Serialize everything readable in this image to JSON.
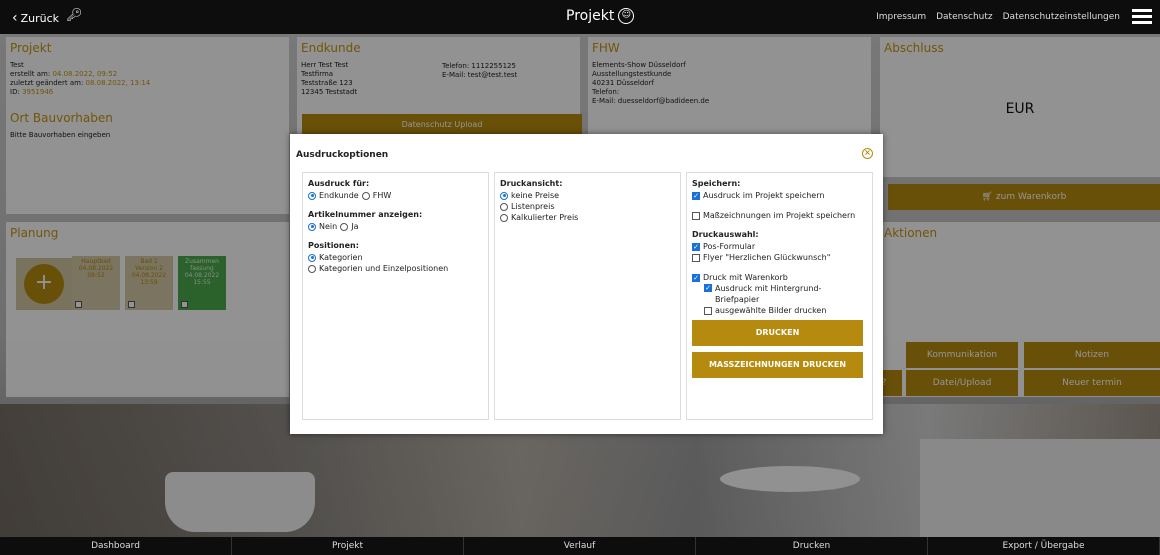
{
  "topbar": {
    "back_label": "Zurück",
    "title": "Projekt",
    "links": [
      "Impressum",
      "Datenschutz",
      "Datenschutzeinstellungen"
    ]
  },
  "projekt": {
    "heading": "Projekt",
    "name": "Test",
    "created_label": "erstellt am:",
    "created_value": "04.08.2022, 09:52",
    "modified_label": "zuletzt geändert am:",
    "modified_value": "08.08.2022, 13:14",
    "id_label": "ID:",
    "id_value": "3951946",
    "ort_heading": "Ort Bauvorhaben",
    "ort_text": "Bitte Bauvorhaben eingeben"
  },
  "endkunde": {
    "heading": "Endkunde",
    "lines": [
      "Herr Test Test",
      "Testfirma",
      "Teststraße 123",
      "12345 Teststadt"
    ],
    "phone": "Telefon: 1112255125",
    "email": "E-Mail: test@test.test",
    "upload_label": "Datenschutz Upload"
  },
  "fhw": {
    "heading": "FHW",
    "lines": [
      "Elements-Show Düsseldorf",
      "Ausstellungstestkunde",
      "40231 Düsseldorf",
      "Telefon:",
      "E-Mail: duesseldorf@badideen.de"
    ]
  },
  "abschluss": {
    "heading": "Abschluss",
    "currency": "EUR",
    "cart_label": "zum Warenkorb"
  },
  "planung": {
    "heading": "Planung",
    "tiles": [
      {
        "lines": [
          "Hauptbad",
          "04.08.2022",
          "09:52"
        ],
        "color": "#d3c9a6"
      },
      {
        "lines": [
          "Bad 1",
          "Version 2",
          "04.08.2022",
          "13:59"
        ],
        "color": "#d3c9a6"
      },
      {
        "lines": [
          "Zusammen",
          "fassung",
          "04.08.2022",
          "15:55"
        ],
        "color": "#4aa84a"
      }
    ]
  },
  "aktionen": {
    "heading": "Aktionen",
    "kommunikation": "Kommunikation",
    "notizen": "Notizen",
    "q": "?",
    "datei": "Datei/Upload",
    "termin": "Neuer termin"
  },
  "modal": {
    "title": "Ausdruckoptionen",
    "ausdruck_fuer": {
      "label": "Ausdruck für:",
      "options": [
        "Endkunde",
        "FHW"
      ],
      "selected": 0
    },
    "artikelnummer": {
      "label": "Artikelnummer anzeigen:",
      "options": [
        "Nein",
        "Ja"
      ],
      "selected": 0
    },
    "positionen": {
      "label": "Positionen:",
      "options": [
        "Kategorien",
        "Kategorien und Einzelpositionen"
      ],
      "selected": 0
    },
    "druckansicht": {
      "label": "Druckansicht:",
      "options": [
        "keine Preise",
        "Listenpreis",
        "Kalkulierter Preis"
      ],
      "selected": 0
    },
    "speichern": {
      "label": "Speichern:",
      "opt1": "Ausdruck im Projekt speichern",
      "opt1_checked": true,
      "opt2": "Maßzeichnungen im Projekt speichern",
      "opt2_checked": false
    },
    "druckauswahl": {
      "label": "Druckauswahl:",
      "pos": "Pos-Formular",
      "pos_checked": true,
      "flyer": "Flyer \"Herzlichen Glückwunsch\"",
      "flyer_checked": false,
      "warenkorb": "Druck mit Warenkorb",
      "warenkorb_checked": true,
      "hintergrund": "Ausdruck mit Hintergrund-Briefpapier",
      "hintergrund_checked": true,
      "bilder": "ausgewählte Bilder drucken",
      "bilder_checked": false
    },
    "drucken_label": "DRUCKEN",
    "mass_label": "MASSZEICHNUNGEN DRUCKEN"
  },
  "bottombar": [
    "Dashboard",
    "Projekt",
    "Verlauf",
    "Drucken",
    "Export / Übergabe"
  ],
  "colors": {
    "accent": "#b58a0f",
    "green": "#4aa84a",
    "checkbox": "#1a6fd8"
  }
}
